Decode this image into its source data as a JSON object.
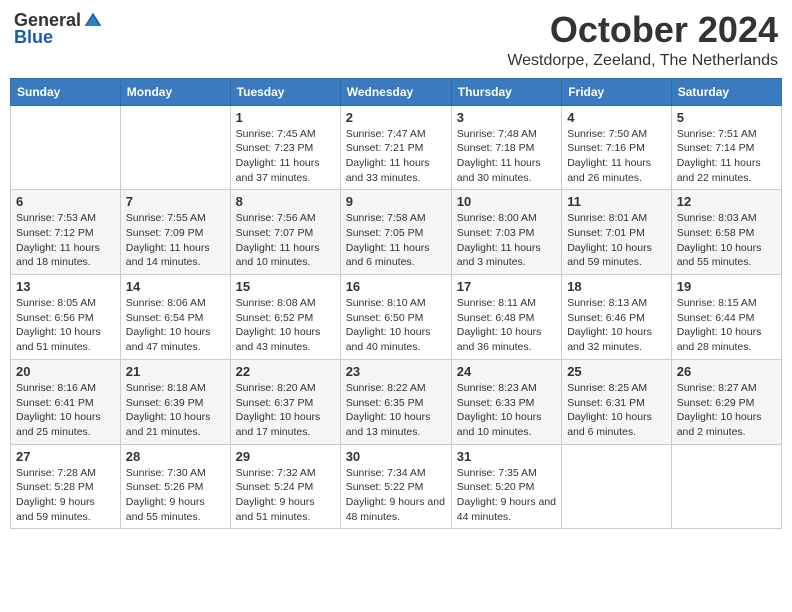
{
  "header": {
    "logo": {
      "general": "General",
      "blue": "Blue"
    },
    "title": "October 2024",
    "location": "Westdorpe, Zeeland, The Netherlands"
  },
  "calendar": {
    "days_of_week": [
      "Sunday",
      "Monday",
      "Tuesday",
      "Wednesday",
      "Thursday",
      "Friday",
      "Saturday"
    ],
    "weeks": [
      [
        {
          "day": "",
          "info": ""
        },
        {
          "day": "",
          "info": ""
        },
        {
          "day": "1",
          "info": "Sunrise: 7:45 AM\nSunset: 7:23 PM\nDaylight: 11 hours and 37 minutes."
        },
        {
          "day": "2",
          "info": "Sunrise: 7:47 AM\nSunset: 7:21 PM\nDaylight: 11 hours and 33 minutes."
        },
        {
          "day": "3",
          "info": "Sunrise: 7:48 AM\nSunset: 7:18 PM\nDaylight: 11 hours and 30 minutes."
        },
        {
          "day": "4",
          "info": "Sunrise: 7:50 AM\nSunset: 7:16 PM\nDaylight: 11 hours and 26 minutes."
        },
        {
          "day": "5",
          "info": "Sunrise: 7:51 AM\nSunset: 7:14 PM\nDaylight: 11 hours and 22 minutes."
        }
      ],
      [
        {
          "day": "6",
          "info": "Sunrise: 7:53 AM\nSunset: 7:12 PM\nDaylight: 11 hours and 18 minutes."
        },
        {
          "day": "7",
          "info": "Sunrise: 7:55 AM\nSunset: 7:09 PM\nDaylight: 11 hours and 14 minutes."
        },
        {
          "day": "8",
          "info": "Sunrise: 7:56 AM\nSunset: 7:07 PM\nDaylight: 11 hours and 10 minutes."
        },
        {
          "day": "9",
          "info": "Sunrise: 7:58 AM\nSunset: 7:05 PM\nDaylight: 11 hours and 6 minutes."
        },
        {
          "day": "10",
          "info": "Sunrise: 8:00 AM\nSunset: 7:03 PM\nDaylight: 11 hours and 3 minutes."
        },
        {
          "day": "11",
          "info": "Sunrise: 8:01 AM\nSunset: 7:01 PM\nDaylight: 10 hours and 59 minutes."
        },
        {
          "day": "12",
          "info": "Sunrise: 8:03 AM\nSunset: 6:58 PM\nDaylight: 10 hours and 55 minutes."
        }
      ],
      [
        {
          "day": "13",
          "info": "Sunrise: 8:05 AM\nSunset: 6:56 PM\nDaylight: 10 hours and 51 minutes."
        },
        {
          "day": "14",
          "info": "Sunrise: 8:06 AM\nSunset: 6:54 PM\nDaylight: 10 hours and 47 minutes."
        },
        {
          "day": "15",
          "info": "Sunrise: 8:08 AM\nSunset: 6:52 PM\nDaylight: 10 hours and 43 minutes."
        },
        {
          "day": "16",
          "info": "Sunrise: 8:10 AM\nSunset: 6:50 PM\nDaylight: 10 hours and 40 minutes."
        },
        {
          "day": "17",
          "info": "Sunrise: 8:11 AM\nSunset: 6:48 PM\nDaylight: 10 hours and 36 minutes."
        },
        {
          "day": "18",
          "info": "Sunrise: 8:13 AM\nSunset: 6:46 PM\nDaylight: 10 hours and 32 minutes."
        },
        {
          "day": "19",
          "info": "Sunrise: 8:15 AM\nSunset: 6:44 PM\nDaylight: 10 hours and 28 minutes."
        }
      ],
      [
        {
          "day": "20",
          "info": "Sunrise: 8:16 AM\nSunset: 6:41 PM\nDaylight: 10 hours and 25 minutes."
        },
        {
          "day": "21",
          "info": "Sunrise: 8:18 AM\nSunset: 6:39 PM\nDaylight: 10 hours and 21 minutes."
        },
        {
          "day": "22",
          "info": "Sunrise: 8:20 AM\nSunset: 6:37 PM\nDaylight: 10 hours and 17 minutes."
        },
        {
          "day": "23",
          "info": "Sunrise: 8:22 AM\nSunset: 6:35 PM\nDaylight: 10 hours and 13 minutes."
        },
        {
          "day": "24",
          "info": "Sunrise: 8:23 AM\nSunset: 6:33 PM\nDaylight: 10 hours and 10 minutes."
        },
        {
          "day": "25",
          "info": "Sunrise: 8:25 AM\nSunset: 6:31 PM\nDaylight: 10 hours and 6 minutes."
        },
        {
          "day": "26",
          "info": "Sunrise: 8:27 AM\nSunset: 6:29 PM\nDaylight: 10 hours and 2 minutes."
        }
      ],
      [
        {
          "day": "27",
          "info": "Sunrise: 7:28 AM\nSunset: 5:28 PM\nDaylight: 9 hours and 59 minutes."
        },
        {
          "day": "28",
          "info": "Sunrise: 7:30 AM\nSunset: 5:26 PM\nDaylight: 9 hours and 55 minutes."
        },
        {
          "day": "29",
          "info": "Sunrise: 7:32 AM\nSunset: 5:24 PM\nDaylight: 9 hours and 51 minutes."
        },
        {
          "day": "30",
          "info": "Sunrise: 7:34 AM\nSunset: 5:22 PM\nDaylight: 9 hours and 48 minutes."
        },
        {
          "day": "31",
          "info": "Sunrise: 7:35 AM\nSunset: 5:20 PM\nDaylight: 9 hours and 44 minutes."
        },
        {
          "day": "",
          "info": ""
        },
        {
          "day": "",
          "info": ""
        }
      ]
    ]
  }
}
